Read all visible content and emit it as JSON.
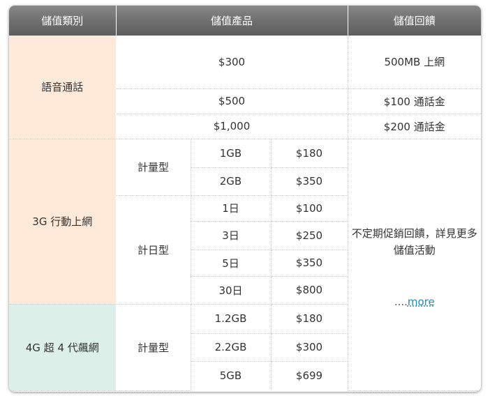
{
  "headers": [
    "儲值類別",
    "儲值產品",
    "儲值回饋"
  ],
  "voice": {
    "category": "語音通話",
    "rows": [
      {
        "product": "$300",
        "reward": "500MB 上網"
      },
      {
        "product": "$500",
        "reward": "$100 通話金"
      },
      {
        "product": "$1,000",
        "reward": "$200 通話金"
      }
    ]
  },
  "g3": {
    "category": "3G 行動上網",
    "metered_label": "計量型",
    "metered": [
      {
        "amount": "1GB",
        "price": "$180"
      },
      {
        "amount": "2GB",
        "price": "$350"
      }
    ],
    "daily_label": "計日型",
    "daily": [
      {
        "amount": "1日",
        "price": "$100"
      },
      {
        "amount": "3日",
        "price": "$250"
      },
      {
        "amount": "5日",
        "price": "$350"
      },
      {
        "amount": "30日",
        "price": "$800"
      }
    ]
  },
  "g4": {
    "category": "4G 超 4 代飆網",
    "metered_label": "計量型",
    "metered": [
      {
        "amount": "1.2GB",
        "price": "$180"
      },
      {
        "amount": "2.2GB",
        "price": "$300"
      },
      {
        "amount": "5GB",
        "price": "$699"
      }
    ]
  },
  "promo": {
    "text": "不定期促銷回饋，詳見更多儲值活動",
    "more_dots": "....",
    "more_label": "more"
  },
  "colors": {
    "header_bg": "#6e6e6e",
    "voice_3g_bg": "#ffe9d9",
    "g4_bg": "#dcefe8",
    "link": "#1a8fb8"
  }
}
